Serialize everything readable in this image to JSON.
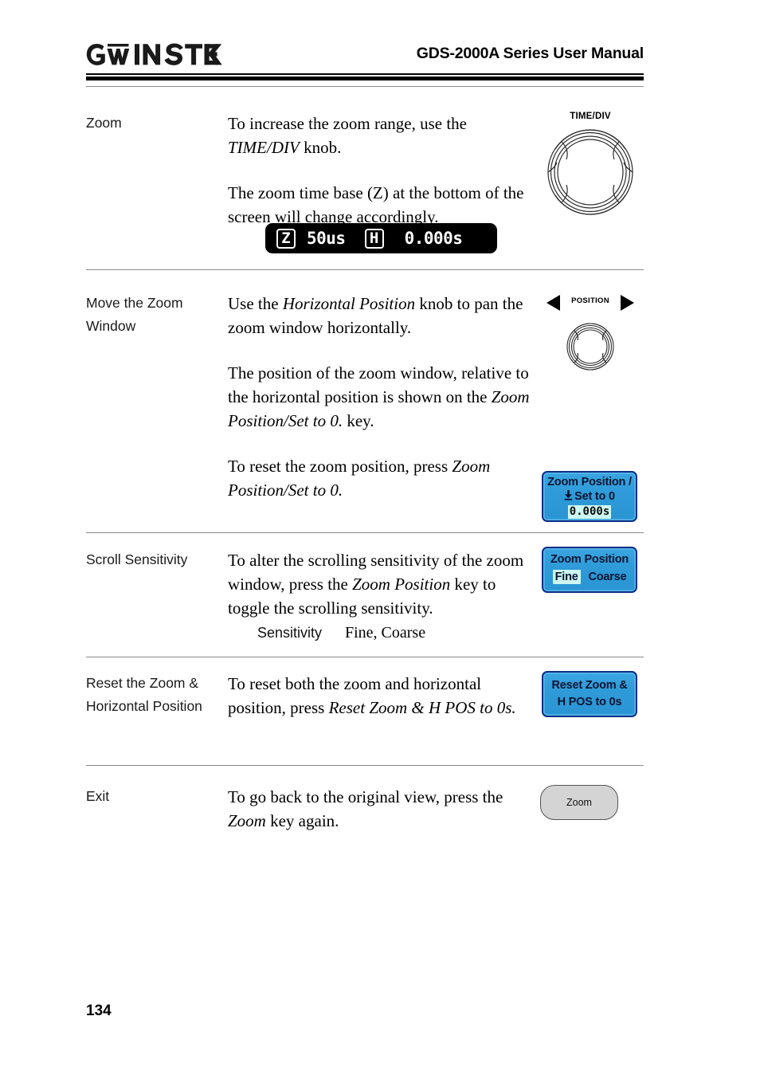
{
  "header": {
    "logo_text": "GW INSTEK",
    "title": "GDS-2000A Series User Manual"
  },
  "sections": [
    {
      "label": "Zoom",
      "paragraphs": [
        "To increase the zoom range, use the TIME/DIV knob.",
        "The zoom time base (Z) at the bottom of the screen will change accordingly."
      ],
      "art": {
        "kind": "knob",
        "caption": "TIME/DIV"
      },
      "scope_readout": {
        "zoom_tag": "Z",
        "zoom_value": "50us",
        "horiz_tag": "H",
        "horiz_value": "0.000s"
      }
    },
    {
      "label": "Move the Zoom Window",
      "paragraphs": [
        "Use the Horizontal Position knob to pan the zoom window horizontally.",
        "The position of the zoom window, relative to the horizontal position is shown on the Zoom Position/Set to 0. key.",
        "To reset the zoom position, press Zoom Position/Set to 0."
      ],
      "art": {
        "kind": "position-knob",
        "caption": "POSITION"
      },
      "softkey": {
        "line1": "Zoom Position /",
        "line2": "Set to 0",
        "value": "0.000s"
      }
    },
    {
      "label": "Scroll Sensitivity",
      "paragraphs": [
        "To alter the scrolling sensitivity of the zoom window, press the Zoom Position key to toggle the scrolling sensitivity."
      ],
      "softkey": {
        "line1": "Zoom Position",
        "option_selected": "Fine",
        "option_other": "Coarse"
      },
      "subnote": {
        "key": "Sensitivity",
        "value": "Fine, Coarse"
      }
    },
    {
      "label": "Reset the Zoom & Horizontal Position",
      "paragraphs": [
        "To reset both the zoom and horizontal position, press Reset Zoom & H POS to 0s."
      ],
      "softkey": {
        "line1": "Reset Zoom &",
        "line2": "H POS to 0s"
      }
    },
    {
      "label": "Exit",
      "paragraphs": [
        "To go back to the original view, press the Zoom key again."
      ],
      "greykey": {
        "label": "Zoom"
      }
    }
  ],
  "footer": {
    "page_number": "134"
  },
  "colors": {
    "softkey_blue": "#2e9ad8",
    "softkey_border": "#0b2f84",
    "softkey_highlight": "#ccf6f1",
    "rule_grey": "#8a8a8a",
    "greykey_fill": "#d4d4d4"
  }
}
